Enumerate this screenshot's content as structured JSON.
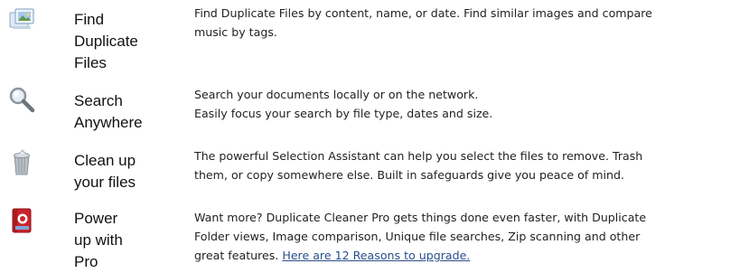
{
  "features": [
    {
      "icon": "find-duplicates-icon",
      "title": "Find\nDuplicate\nFiles",
      "description": "Find Duplicate Files by content, name, or date. Find similar images and compare\nmusic by tags."
    },
    {
      "icon": "magnifier-icon",
      "title": "Search\nAnywhere",
      "description": "Search your documents locally or on the network.\nEasily focus your search by file type, dates and size."
    },
    {
      "icon": "trash-bin-icon",
      "title": "Clean up\nyour files",
      "description": "The powerful Selection Assistant can help you select the files to remove. Trash\nthem, or copy somewhere else. Built in safeguards give you peace of mind."
    },
    {
      "icon": "pro-box-icon",
      "title": "Power\nup with\nPro",
      "description": "Want more? Duplicate Cleaner Pro gets things done even faster, with Duplicate\nFolder views, Image comparison, Unique file searches, Zip scanning and other\ngreat features. ",
      "link_text": "Here are 12 Reasons to upgrade."
    }
  ]
}
